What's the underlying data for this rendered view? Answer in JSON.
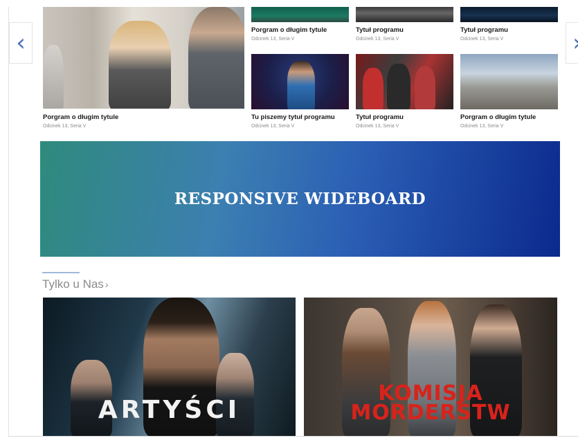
{
  "carousel": {
    "prev_icon": "chevron-left-icon",
    "next_icon": "chevron-right-icon",
    "prev_glyph": "‹",
    "next_glyph": "›",
    "featured": {
      "title": "Porgram o długim tytule",
      "subtitle": "Odcinek 13, Seria V"
    },
    "tiles": [
      {
        "title": "Porgram o długim tytule",
        "subtitle": "Odcinek 13, Seria V"
      },
      {
        "title": "Tytuł programu",
        "subtitle": "Odcinek 13, Seria V"
      },
      {
        "title": "Tytuł programu",
        "subtitle": "Odcinek 13, Seria V"
      },
      {
        "title": "Tu piszemy tytuł programu",
        "subtitle": "Odcinek 13, Seria V"
      },
      {
        "title": "Tytuł programu",
        "subtitle": "Odcinek 13, Seria V"
      },
      {
        "title": "Porgram o długim tytule",
        "subtitle": "Odcinek 13, Seria V"
      }
    ]
  },
  "wideboard": {
    "label": "RESPONSIVE WIDEBOARD"
  },
  "section": {
    "title": "Tylko u Nas",
    "chevron": "›"
  },
  "features": [
    {
      "logo": "ARTYŚCI"
    },
    {
      "logo_line1": "KOMISJA",
      "logo_line2": "MORDERSTW"
    }
  ],
  "colors": {
    "accent": "#4a6fb3",
    "wideboard_start": "#2f8a7c",
    "wideboard_end": "#0b2a8e",
    "komisja_red": "#d8231b"
  }
}
